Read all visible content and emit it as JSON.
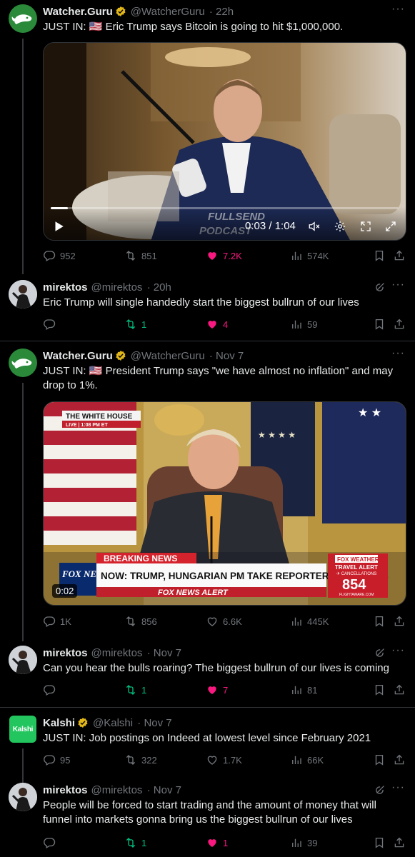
{
  "tweets": [
    {
      "name": "Watcher.Guru",
      "handle": "@WatcherGuru",
      "time": "22h",
      "text": "JUST IN: 🇺🇸 Eric Trump says Bitcoin is going to hit $1,000,000.",
      "video": {
        "time": "0:03 / 1:04",
        "progress": 0.05,
        "overlay_text": "FULLSEND PODCAST"
      },
      "actions": {
        "replies": "952",
        "reposts": "851",
        "likes": "7.2K",
        "views": "574K"
      }
    },
    {
      "name": "mirektos",
      "handle": "@mirektos",
      "time": "20h",
      "text": "Eric Trump will single handedly start the biggest bullrun of our lives",
      "actions": {
        "replies": "",
        "reposts": "1",
        "likes": "4",
        "views": "59"
      }
    },
    {
      "name": "Watcher.Guru",
      "handle": "@WatcherGuru",
      "time": "Nov 7",
      "text": "JUST IN: 🇺🇸 President Trump says \"we have almost no inflation\" and may drop to 1%.",
      "video": {
        "duration": "0:02",
        "chyron_top": "THE WHITE HOUSE",
        "chyron_live": "LIVE | 1:08 PM ET",
        "breaking": "BREAKING NEWS",
        "headline": "NOW: TRUMP, HUNGARIAN PM TAKE REPORTER QUESTIONS",
        "alert": "FOX NEWS ALERT",
        "fox_logo": "FOX NEWS",
        "weather_title": "FOX WEATHER",
        "weather_sub": "TRAVEL ALERT",
        "weather_sub2": "✈ CANCELLATIONS",
        "weather_num": "854",
        "weather_src": "FLIGHTAWARE.COM"
      },
      "actions": {
        "replies": "1K",
        "reposts": "856",
        "likes": "6.6K",
        "views": "445K"
      }
    },
    {
      "name": "mirektos",
      "handle": "@mirektos",
      "time": "Nov 7",
      "text": "Can you hear the bulls roaring? The biggest bullrun of our lives is coming",
      "actions": {
        "replies": "",
        "reposts": "1",
        "likes": "7",
        "views": "81"
      }
    },
    {
      "name": "Kalshi",
      "handle": "@Kalshi",
      "time": "Nov 7",
      "avatar_text": "Kalshi",
      "text": "JUST IN: Job postings on Indeed at lowest level since February 2021",
      "actions": {
        "replies": "95",
        "reposts": "322",
        "likes": "1.7K",
        "views": "66K"
      }
    },
    {
      "name": "mirektos",
      "handle": "@mirektos",
      "time": "Nov 7",
      "text": "People will be forced to start trading and the amount of money that will funnel into markets  gonna bring us the biggest bullrun of our lives",
      "actions": {
        "replies": "",
        "reposts": "1",
        "likes": "1",
        "views": "39"
      }
    }
  ],
  "colors": {
    "like": "#f91880",
    "repost": "#00ba7c",
    "muted": "#71767b",
    "verified": "#e2b719"
  }
}
